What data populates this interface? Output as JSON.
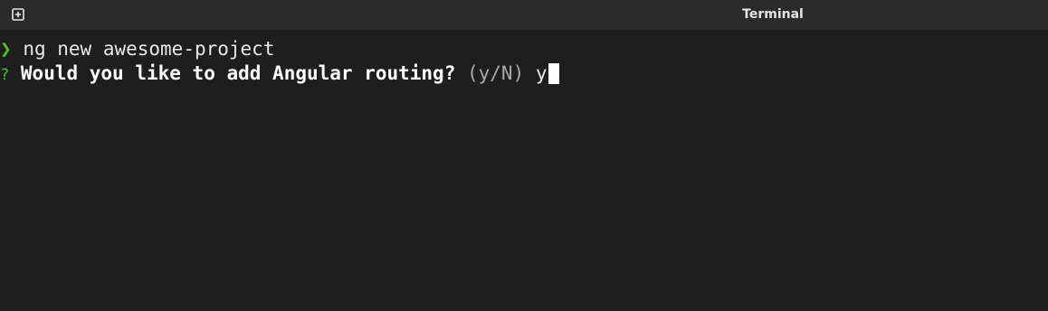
{
  "window": {
    "title": "Terminal"
  },
  "icons": {
    "new_tab": "new-tab-icon"
  },
  "terminal": {
    "line1": {
      "prompt": "❯",
      "command": "ng new awesome-project"
    },
    "line2": {
      "marker": "?",
      "question": "Would you like to add Angular routing?",
      "hint": "(y/N)",
      "answer": "y"
    }
  },
  "colors": {
    "background": "#1e1e1e",
    "titlebar": "#2b2b2b",
    "prompt_green": "#4ec320",
    "text": "#e8e8e8",
    "hint_gray": "#a8a8a8",
    "cursor": "#ffffff"
  }
}
